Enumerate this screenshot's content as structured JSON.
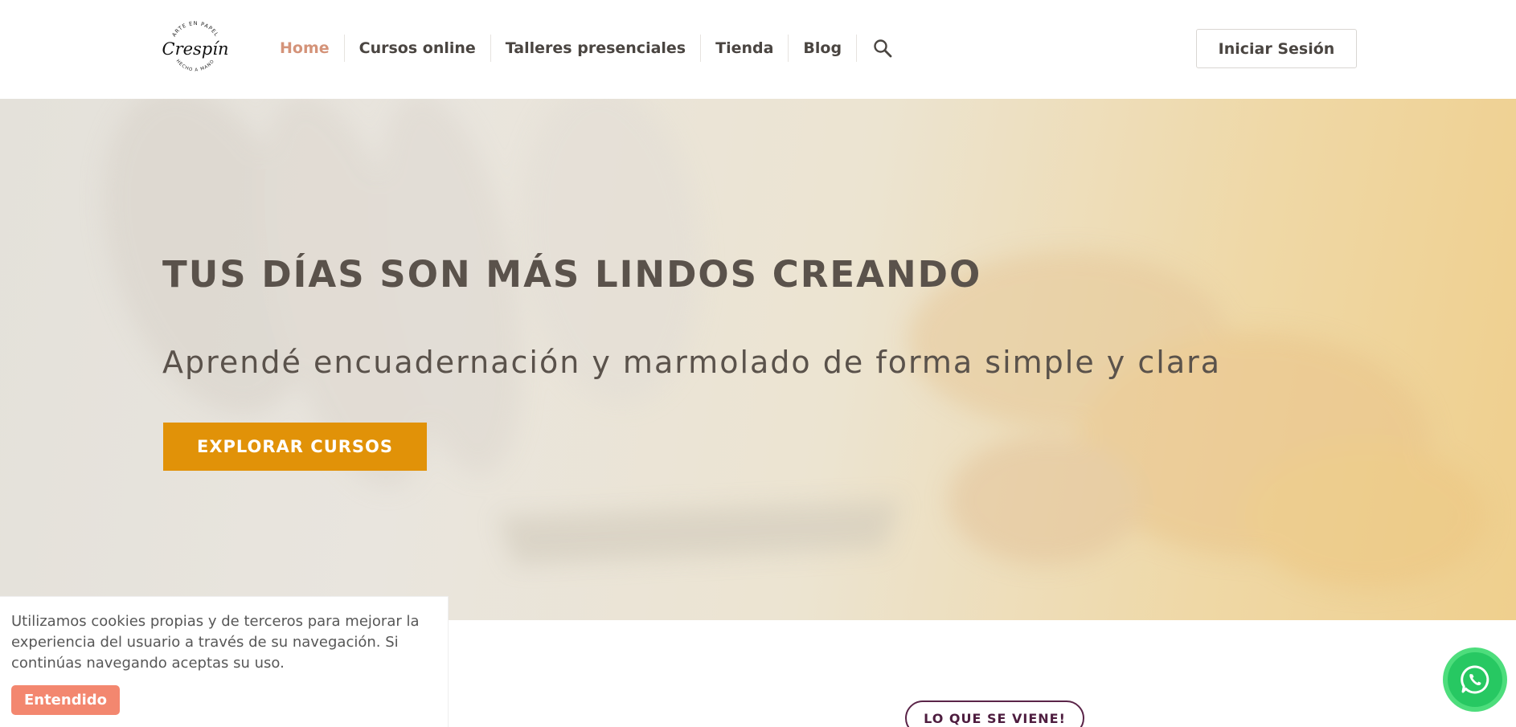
{
  "header": {
    "logo": {
      "top_text": "ARTE EN PAPEL",
      "brand": "Crespín",
      "bottom_text": "HECHO A MANO"
    },
    "nav": [
      {
        "label": "Home",
        "active": true
      },
      {
        "label": "Cursos online",
        "active": false
      },
      {
        "label": "Talleres presenciales",
        "active": false
      },
      {
        "label": "Tienda",
        "active": false
      },
      {
        "label": "Blog",
        "active": false
      }
    ],
    "search_icon": "search-icon",
    "login_label": "Iniciar Sesión"
  },
  "hero": {
    "title": "TUS DÍAS SON MÁS LINDOS CREANDO",
    "subtitle": "Aprendé encuadernación y marmolado de forma simple y clara",
    "cta_label": "EXPLORAR CURSOS"
  },
  "upcoming": {
    "badge_label": "LO QUE SE VIENE!"
  },
  "cookie_banner": {
    "text": "Utilizamos cookies propias y de terceros para mejorar la experiencia del usuario a través de su navegación. Si continúas navegando aceptas su uso.",
    "button_label": "Entendido"
  },
  "whatsapp": {
    "icon": "whatsapp-icon"
  },
  "colors": {
    "accent_nav": "#d49379",
    "cta": "#e19208",
    "cookie_button": "#f3876f",
    "whatsapp": "#27c862",
    "badge_border": "#5a2448",
    "text_dark": "#4a4541"
  }
}
